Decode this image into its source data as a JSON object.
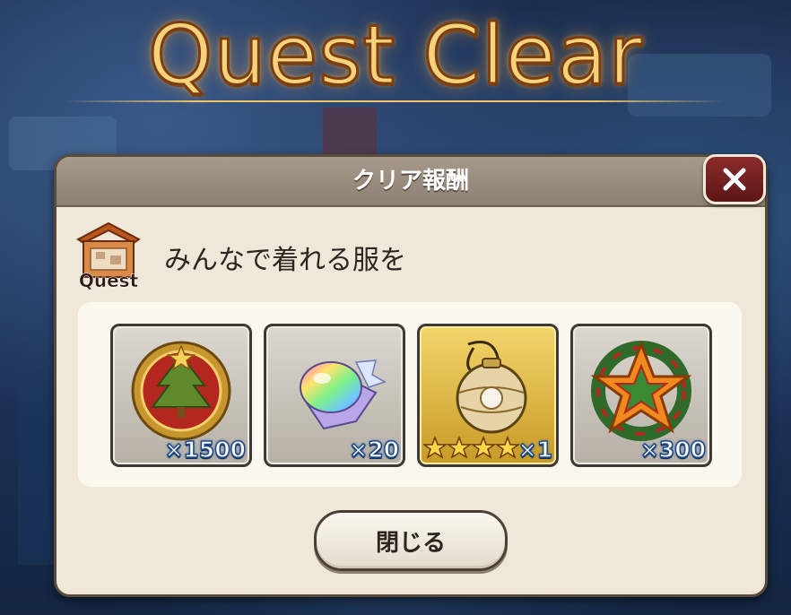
{
  "screen_title": "Quest Clear",
  "dialog": {
    "title": "クリア報酬",
    "close_icon": "close-x-icon",
    "quest_badge_label": "Quest",
    "quest_name": "みんなで着れる服を",
    "close_button_label": "閉じる"
  },
  "rewards": [
    {
      "icon": "christmas-tree-medal-icon",
      "quantity": "×1500"
    },
    {
      "icon": "rainbow-crystal-icon",
      "quantity": "×20"
    },
    {
      "icon": "golden-ornament-icon",
      "quantity": "×1",
      "rarity_stars": 4
    },
    {
      "icon": "christmas-star-wreath-icon",
      "quantity": "×300"
    }
  ],
  "colors": {
    "title_gold": "#f6d27a",
    "dialog_bg": "#efe7d7",
    "header_bg": "#a79a8a",
    "close_red": "#8c2b2b",
    "qty_outline": "#1d4a8c"
  }
}
